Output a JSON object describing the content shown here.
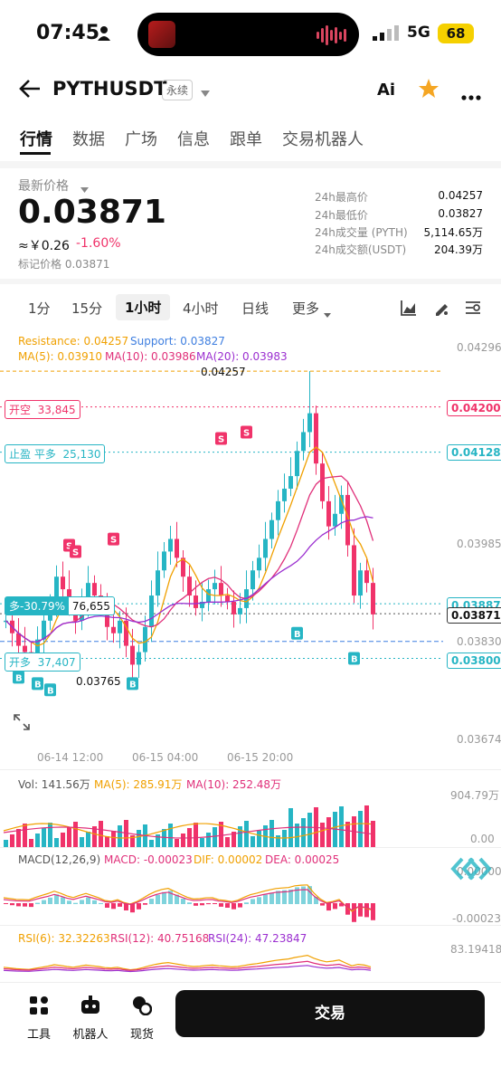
{
  "status": {
    "time": "07:45",
    "network": "5G",
    "battery": "68"
  },
  "header": {
    "symbol": "PYTHUSDT",
    "contract_type": "永续",
    "ai_label": "Ai"
  },
  "tabs": [
    "行情",
    "数据",
    "广场",
    "信息",
    "跟单",
    "交易机器人"
  ],
  "price": {
    "label": "最新价格",
    "last": "0.03871",
    "cny": "≈￥0.26",
    "change": "-1.60%",
    "mark": "标记价格 0.03871"
  },
  "stats": [
    {
      "label": "24h最高价",
      "value": "0.04257"
    },
    {
      "label": "24h最低价",
      "value": "0.03827"
    },
    {
      "label": "24h成交量 (PYTH)",
      "value": "5,114.65万"
    },
    {
      "label": "24h成交额(USDT)",
      "value": "204.39万"
    }
  ],
  "intervals": [
    "1分",
    "15分",
    "1小时",
    "4小时",
    "日线",
    "更多"
  ],
  "chart": {
    "resistance": "Resistance: 0.04257",
    "support": "Support: 0.03827",
    "ma5": "MA(5): 0.03910",
    "ma10": "MA(10): 0.03986",
    "ma20": "MA(20): 0.03983",
    "high_mark": "0.04257",
    "low_mark": "0.03765",
    "y_ticks": [
      "0.04296",
      "0.03985",
      "0.03830",
      "0.03674"
    ],
    "x_ticks": [
      "06-14 12:00",
      "06-15 04:00",
      "06-15 20:00"
    ],
    "open_short": {
      "label": "开空",
      "qty": "33,845",
      "price": "0.04200"
    },
    "take_profit": {
      "label": "止盈 平多",
      "qty": "25,130",
      "price": "0.04128"
    },
    "position": {
      "label": "多-30.79%",
      "qty": "76,655",
      "price": "0.03887"
    },
    "last_price_tag": "0.03871",
    "open_long": {
      "label": "开多",
      "qty": "37,407",
      "price": "0.03800"
    },
    "buy_marker": "B",
    "sell_marker": "S",
    "colors": {
      "up": "#26b5c4",
      "down": "#f0336a",
      "ma5": "#f0a000",
      "ma10": "#e0307a",
      "ma20": "#9b2fd0"
    }
  },
  "volume": {
    "vol": "Vol: 141.56万",
    "ma5": "MA(5): 285.91万",
    "ma10": "MA(10): 252.48万",
    "max": "904.79万",
    "zero": "0.00"
  },
  "macd": {
    "label": "MACD(12,26,9)",
    "macd": "MACD: -0.00023",
    "dif": "DIF: 0.00002",
    "dea": "DEA: 0.00025",
    "top": "0.00000",
    "bottom": "-0.00023"
  },
  "rsi": {
    "rsi6": "RSI(6): 32.32263",
    "rsi12": "RSI(12): 40.75168",
    "rsi24": "RSI(24): 47.23847",
    "top": "83.19418"
  },
  "bottom_nav": {
    "tools": "工具",
    "bots": "机器人",
    "spot": "现货",
    "trade": "交易"
  },
  "chart_data": {
    "type": "candlestick",
    "x_ticks": [
      "06-14 12:00",
      "06-15 04:00",
      "06-15 20:00"
    ],
    "ylim": [
      0.03674,
      0.04296
    ],
    "high": 0.04257,
    "low": 0.03765,
    "ma_last": {
      "MA(5)": 0.0391,
      "MA(10)": 0.03986,
      "MA(20)": 0.03983
    }
  }
}
